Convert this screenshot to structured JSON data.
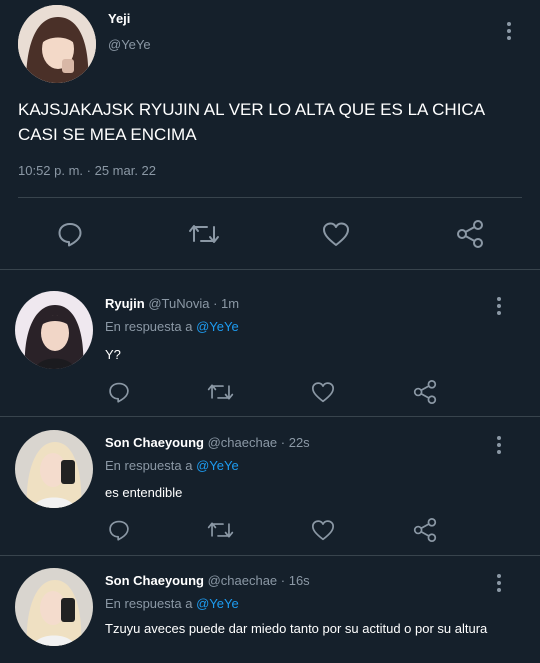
{
  "main_tweet": {
    "name": "Yeji",
    "handle": "@YeYe",
    "text": "KAJSJAKAJSK RYUJIN AL VER LO ALTA QUE ES LA CHICA CASI SE MEA ENCIMA",
    "timestamp": "10:52 p. m. · 25 mar. 22"
  },
  "action_icons": [
    "reply-icon",
    "retweet-icon",
    "like-icon",
    "share-icon"
  ],
  "replies": [
    {
      "name": "Ryujin",
      "handle": "@TuNovia",
      "time": "· 1m",
      "reply_prefix": "En respuesta a",
      "reply_to": "@YeYe",
      "text": "Y?"
    },
    {
      "name": "Son Chaeyoung",
      "handle": "@chaechae",
      "time": "· 22s",
      "reply_prefix": "En respuesta a",
      "reply_to": "@YeYe",
      "text": "es entendible"
    },
    {
      "name": "Son Chaeyoung",
      "handle": "@chaechae",
      "time": "· 16s",
      "reply_prefix": "En respuesta a",
      "reply_to": "@YeYe",
      "text": "Tzuyu aveces puede dar miedo tanto por su actitud o por su altura"
    }
  ],
  "colors": {
    "background": "#15202b",
    "accent": "#1d9bf0",
    "muted": "#8b98a5",
    "divider": "#38444d"
  }
}
